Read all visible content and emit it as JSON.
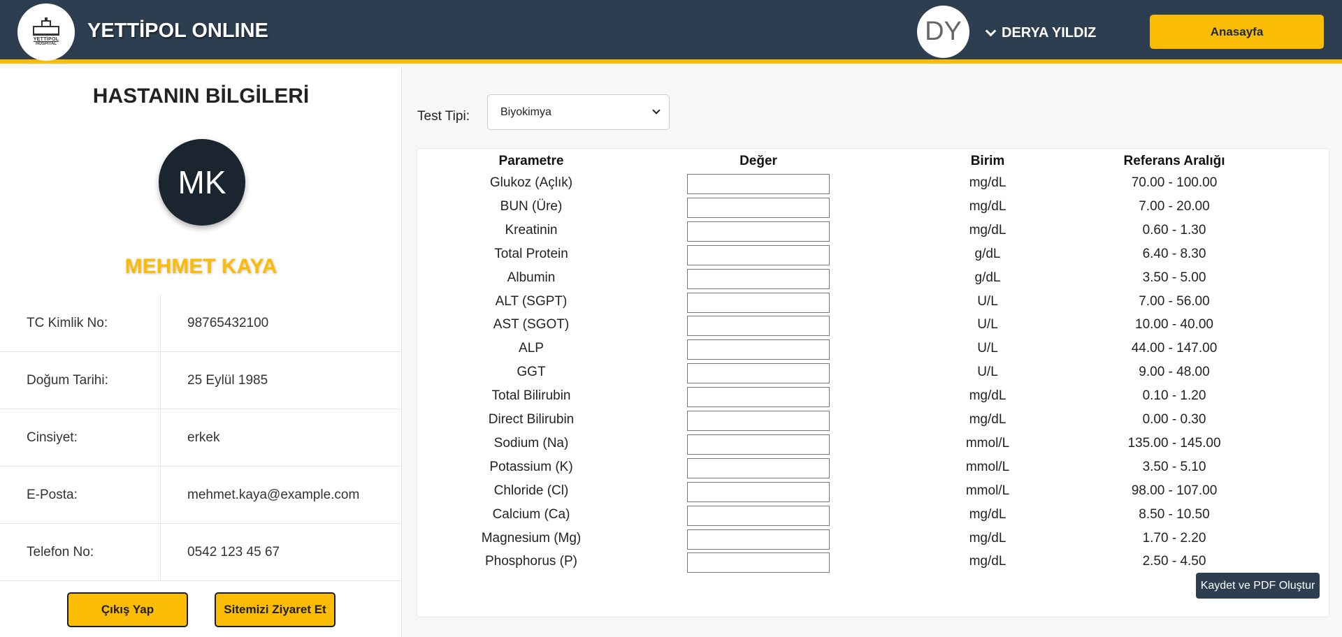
{
  "header": {
    "logo_text": "YETTİPOL",
    "logo_subtext": "HOSPITAL",
    "brand": "YETTİPOL ONLINE",
    "user_initials": "DY",
    "user_name": "DERYA YILDIZ",
    "home_button": "Anasayfa"
  },
  "patient": {
    "section_title": "HASTANIN BİLGİLERİ",
    "initials": "MK",
    "name": "MEHMET KAYA",
    "fields": [
      {
        "label": "TC Kimlik No:",
        "value": "98765432100"
      },
      {
        "label": "Doğum Tarihi:",
        "value": "25 Eylül 1985"
      },
      {
        "label": "Cinsiyet:",
        "value": "erkek"
      },
      {
        "label": "E-Posta:",
        "value": "mehmet.kaya@example.com"
      },
      {
        "label": "Telefon No:",
        "value": "0542 123 45 67"
      }
    ],
    "logout_button": "Çıkış Yap",
    "visit_button": "Sitemizi Ziyaret Et"
  },
  "test": {
    "type_label": "Test Tipi:",
    "type_selected": "Biyokimya",
    "columns": {
      "param": "Parametre",
      "value": "Değer",
      "unit": "Birim",
      "range": "Referans Aralığı"
    },
    "rows": [
      {
        "param": "Glukoz (Açlık)",
        "unit": "mg/dL",
        "range": "70.00 - 100.00",
        "value": ""
      },
      {
        "param": "BUN (Üre)",
        "unit": "mg/dL",
        "range": "7.00 - 20.00",
        "value": ""
      },
      {
        "param": "Kreatinin",
        "unit": "mg/dL",
        "range": "0.60 - 1.30",
        "value": ""
      },
      {
        "param": "Total Protein",
        "unit": "g/dL",
        "range": "6.40 - 8.30",
        "value": ""
      },
      {
        "param": "Albumin",
        "unit": "g/dL",
        "range": "3.50 - 5.00",
        "value": ""
      },
      {
        "param": "ALT (SGPT)",
        "unit": "U/L",
        "range": "7.00 - 56.00",
        "value": ""
      },
      {
        "param": "AST (SGOT)",
        "unit": "U/L",
        "range": "10.00 - 40.00",
        "value": ""
      },
      {
        "param": "ALP",
        "unit": "U/L",
        "range": "44.00 - 147.00",
        "value": ""
      },
      {
        "param": "GGT",
        "unit": "U/L",
        "range": "9.00 - 48.00",
        "value": ""
      },
      {
        "param": "Total Bilirubin",
        "unit": "mg/dL",
        "range": "0.10 - 1.20",
        "value": ""
      },
      {
        "param": "Direct Bilirubin",
        "unit": "mg/dL",
        "range": "0.00 - 0.30",
        "value": ""
      },
      {
        "param": "Sodium (Na)",
        "unit": "mmol/L",
        "range": "135.00 - 145.00",
        "value": ""
      },
      {
        "param": "Potassium (K)",
        "unit": "mmol/L",
        "range": "3.50 - 5.10",
        "value": ""
      },
      {
        "param": "Chloride (Cl)",
        "unit": "mmol/L",
        "range": "98.00 - 107.00",
        "value": ""
      },
      {
        "param": "Calcium (Ca)",
        "unit": "mg/dL",
        "range": "8.50 - 10.50",
        "value": ""
      },
      {
        "param": "Magnesium (Mg)",
        "unit": "mg/dL",
        "range": "1.70 - 2.20",
        "value": ""
      },
      {
        "param": "Phosphorus (P)",
        "unit": "mg/dL",
        "range": "2.50 - 4.50",
        "value": ""
      }
    ],
    "save_button": "Kaydet ve PDF Oluştur"
  },
  "colors": {
    "header_bg": "#2c3e50",
    "accent": "#fbbc05",
    "avatar_dark": "#1b2530"
  }
}
